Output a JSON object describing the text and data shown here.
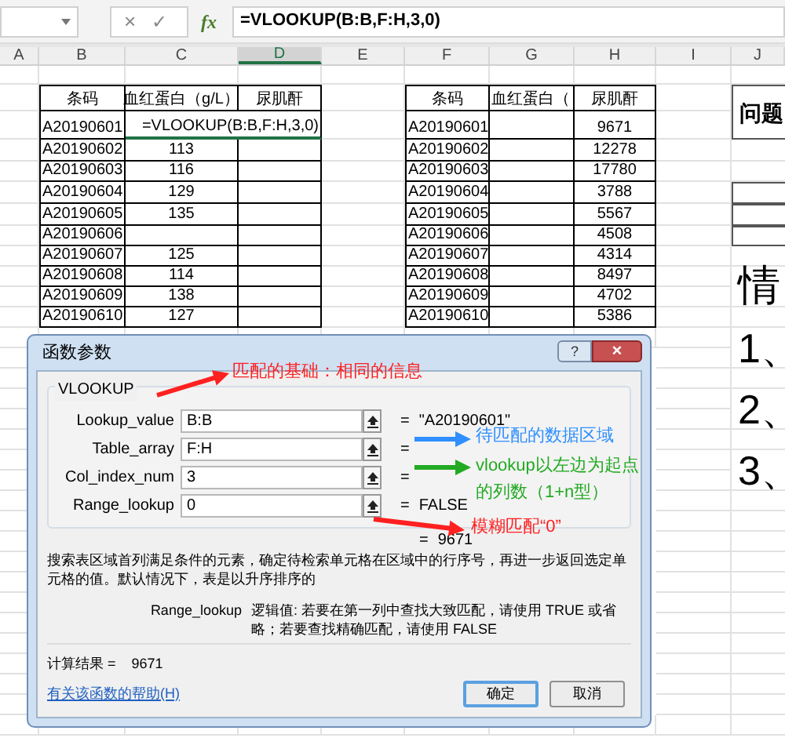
{
  "formula_bar": {
    "cancel": "×",
    "confirm": "✓",
    "fx": "fx",
    "formula": "=VLOOKUP(B:B,F:H,3,0)"
  },
  "columns": [
    {
      "label": "A",
      "selected": false
    },
    {
      "label": "B",
      "selected": false
    },
    {
      "label": "C",
      "selected": false
    },
    {
      "label": "D",
      "selected": true
    },
    {
      "label": "E",
      "selected": false
    },
    {
      "label": "F",
      "selected": false
    },
    {
      "label": "G",
      "selected": false
    },
    {
      "label": "H",
      "selected": false
    },
    {
      "label": "I",
      "selected": false
    },
    {
      "label": "J",
      "selected": false
    }
  ],
  "left_table": {
    "headers": [
      "条码",
      "血红蛋白（g/L）",
      "尿肌酐"
    ],
    "rows": [
      [
        "A20190601",
        "",
        "=VLOOKUP(B:B,F:H,3,0)"
      ],
      [
        "A20190602",
        "113",
        ""
      ],
      [
        "A20190603",
        "116",
        ""
      ],
      [
        "A20190604",
        "129",
        ""
      ],
      [
        "A20190605",
        "135",
        ""
      ],
      [
        "A20190606",
        "",
        ""
      ],
      [
        "A20190607",
        "125",
        ""
      ],
      [
        "A20190608",
        "114",
        ""
      ],
      [
        "A20190609",
        "138",
        ""
      ],
      [
        "A20190610",
        "127",
        ""
      ]
    ]
  },
  "right_table": {
    "headers": [
      "条码",
      "血红蛋白（",
      "尿肌酐"
    ],
    "rows": [
      [
        "A20190601",
        "",
        "9671"
      ],
      [
        "A20190602",
        "",
        "12278"
      ],
      [
        "A20190603",
        "",
        "17780"
      ],
      [
        "A20190604",
        "",
        "3788"
      ],
      [
        "A20190605",
        "",
        "5567"
      ],
      [
        "A20190606",
        "",
        "4508"
      ],
      [
        "A20190607",
        "",
        "4314"
      ],
      [
        "A20190608",
        "",
        "8497"
      ],
      [
        "A20190609",
        "",
        "4702"
      ],
      [
        "A20190610",
        "",
        "5386"
      ]
    ]
  },
  "side_notes": [
    {
      "text": "问题",
      "kind": "box"
    },
    {
      "text": "情",
      "kind": "heading"
    },
    {
      "text": "1、",
      "kind": "item"
    },
    {
      "text": "2、",
      "kind": "item"
    },
    {
      "text": "3、",
      "kind": "item"
    }
  ],
  "dialog": {
    "title": "函数参数",
    "help": "?",
    "close": "×",
    "function": "VLOOKUP",
    "args": [
      {
        "name": "Lookup_value",
        "value": "B:B",
        "result": "\"A20190601\""
      },
      {
        "name": "Table_array",
        "value": "F:H"
      },
      {
        "name": "Col_index_num",
        "value": "3"
      },
      {
        "name": "Range_lookup",
        "value": "0",
        "result": "FALSE"
      }
    ],
    "equals": "=",
    "result": "9671",
    "description": "搜索表区域首列满足条件的元素，确定待检索单元格在区域中的行序号，再进一步返回选定单元格的值。默认情况下，表是以升序排序的",
    "arg_help_name": "Range_lookup",
    "arg_help_text": "逻辑值: 若要在第一列中查找大致匹配，请使用 TRUE 或省略；若要查找精确匹配，请使用 FALSE",
    "calc_label": "计算结果 =",
    "calc_value": "9671",
    "help_link": "有关该函数的帮助(H)",
    "buttons": [
      {
        "label": "确定",
        "selected": true
      },
      {
        "label": "取消",
        "selected": false
      }
    ]
  },
  "annotations": [
    {
      "text": "匹配的基础：相同的信息",
      "color": "#ff2020"
    },
    {
      "text": "待匹配的数据区域",
      "color": "#2f8fff"
    },
    {
      "text": "vlookup以左边为起点的列数（1+n型）",
      "color": "#22aa22"
    },
    {
      "text": "模糊匹配“0”",
      "color": "#ff2020"
    }
  ]
}
